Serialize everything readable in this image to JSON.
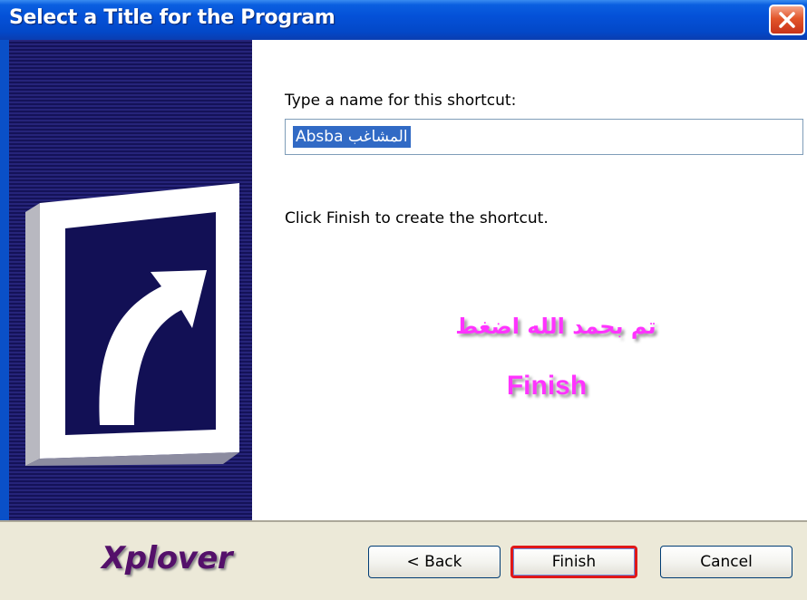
{
  "window": {
    "title": "Select a Title for the Program"
  },
  "form": {
    "prompt_label": "Type a name for this shortcut:",
    "shortcut_name": "Absba المشاغب",
    "finish_hint": "Click Finish to create the shortcut."
  },
  "annotation": {
    "arabic_text": "تم بحمد الله اضغط",
    "finish_text": "Finish",
    "color": "#ff33ff"
  },
  "footer": {
    "brand": "Xplover"
  },
  "buttons": {
    "back": "< Back",
    "finish": "Finish",
    "cancel": "Cancel"
  },
  "icons": {
    "close": "close-icon",
    "shortcut": "shortcut-arrow-icon"
  }
}
